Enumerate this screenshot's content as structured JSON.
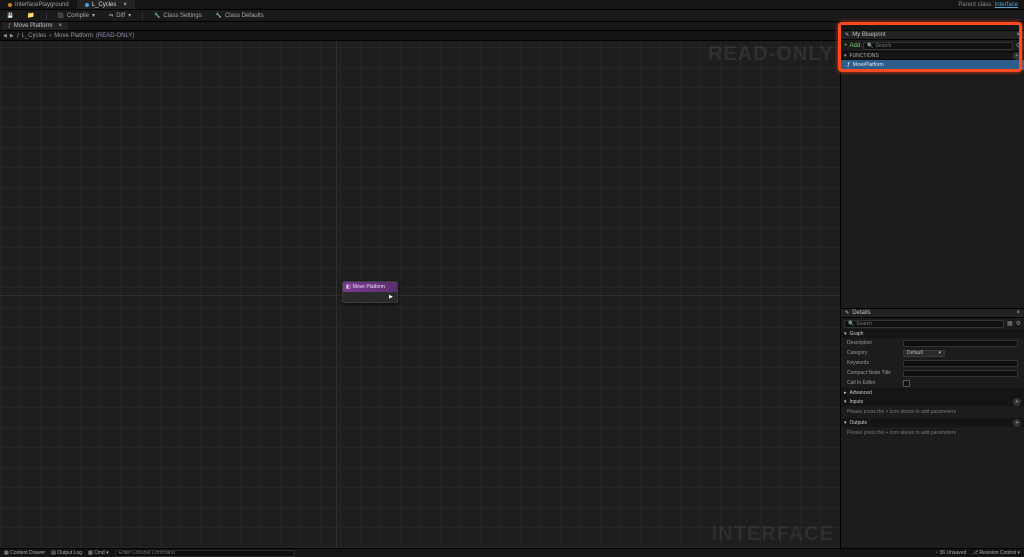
{
  "file_tabs": {
    "tab0": "InterfacePlayground",
    "tab1": "L_Cycles"
  },
  "parent_class": {
    "label": "Parent class:",
    "value": "Interface"
  },
  "toolbar": {
    "save": "",
    "compile": "Compile",
    "diff": "Diff",
    "class_settings": "Class Settings",
    "class_defaults": "Class Defaults"
  },
  "sub_tab": {
    "label": "Move Platform"
  },
  "breadcrumb": {
    "root": "L_Cycles",
    "item": "Move Platform",
    "readonly": "(READ-ONLY)"
  },
  "graph": {
    "watermark_top": "READ-ONLY",
    "watermark_bottom": "INTERFACE",
    "node_title": "Move Platform"
  },
  "my_blueprint": {
    "title": "My Blueprint",
    "add_label": "Add",
    "search_placeholder": "Search",
    "functions_header": "FUNCTIONS",
    "fn_item": "MovePlatform"
  },
  "details": {
    "title": "Details",
    "search_placeholder": "Search",
    "graph_header": "Graph",
    "rows": {
      "description_label": "Description",
      "category_label": "Category",
      "category_value": "Default",
      "keywords_label": "Keywords",
      "compact_label": "Compact Node Title",
      "editor_label": "Call In Editor"
    },
    "advanced_header": "Advanced",
    "inputs_header": "Inputs",
    "inputs_hint": "Please press the + icon above to add parameters",
    "outputs_header": "Outputs",
    "outputs_hint": "Please press the + icon above to add parameters"
  },
  "status": {
    "content_drawer": "Content Drawer",
    "output_log": "Output Log",
    "cmd": "Cmd",
    "cmd_placeholder": "Enter Console Command",
    "unsaved_count": "36 Unsaved",
    "revision": "Revision Control"
  }
}
